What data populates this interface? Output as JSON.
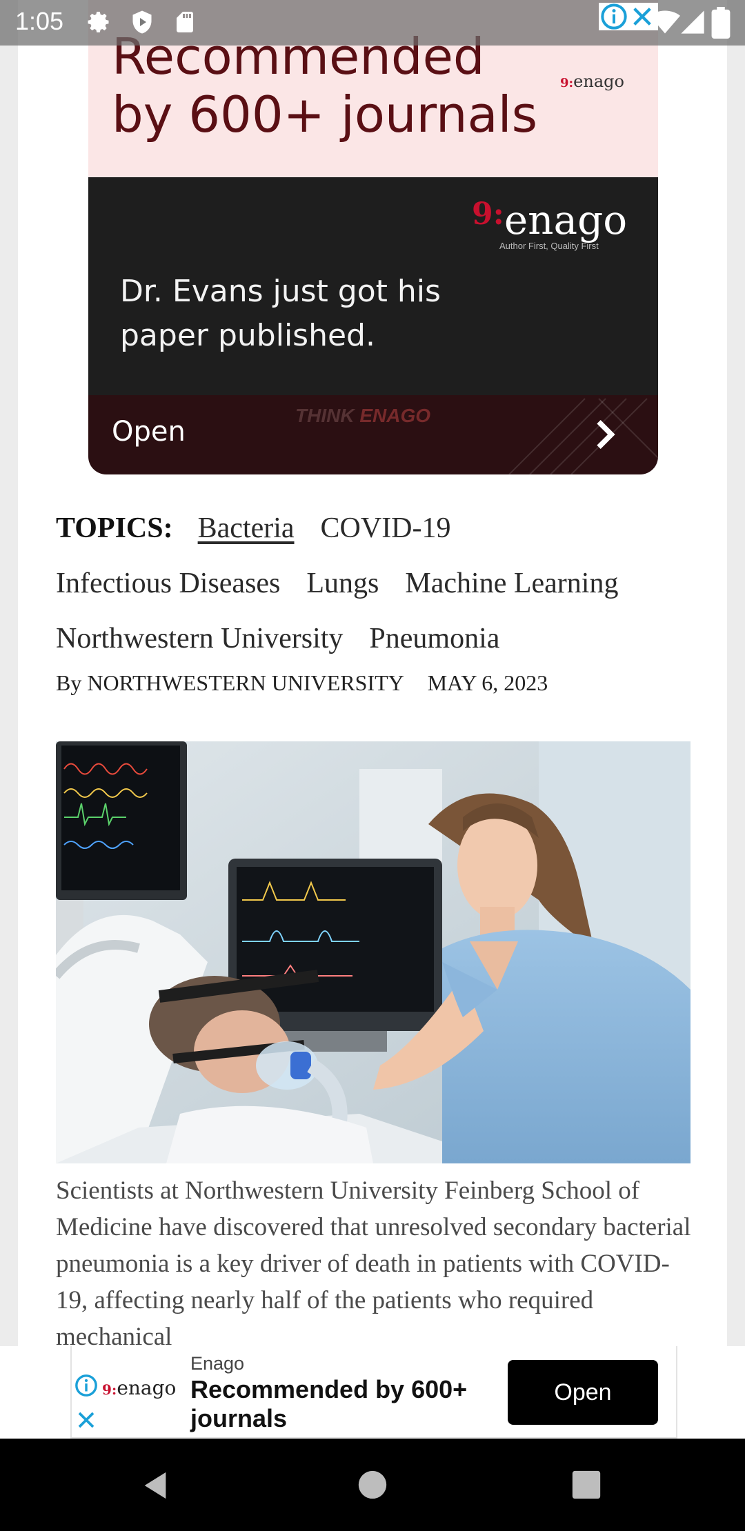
{
  "status_bar": {
    "time": "1:05",
    "icons": [
      "gear-icon",
      "shield-play-icon",
      "sd-card-icon",
      "wifi-icon",
      "signal-icon",
      "battery-icon"
    ]
  },
  "top_ad": {
    "headline": "Recommended by 600+ journals",
    "brand": "enago",
    "brand_tagline": "Author First, Quality First",
    "message": "Dr. Evans just got his paper published.",
    "cta_label": "Open",
    "watermark_think": "THINK",
    "watermark_brand": "ENAGO",
    "colors": {
      "pink": "#fbe6e6",
      "headline": "#5a0f14",
      "dark": "#1e1e1e",
      "cta_bg": "#2b0f12",
      "accent": "#c8102e"
    }
  },
  "topics": {
    "label": "TOPICS:",
    "tags": [
      "Bacteria",
      "COVID-19",
      "Infectious Diseases",
      "Lungs",
      "Machine Learning",
      "Northwestern University",
      "Pneumonia"
    ]
  },
  "byline": {
    "author": "By NORTHWESTERN UNIVERSITY",
    "date": "MAY 6, 2023"
  },
  "hero_image": {
    "subject": "nurse-with-ventilated-patient"
  },
  "caption": "Scientists at Northwestern University Feinberg School of Medicine have discovered that unresolved secondary bacterial pneumonia is a key driver of death in patients with COVID-19, affecting nearly half of the patients who required mechanical",
  "bottom_ad": {
    "advertiser": "Enago",
    "title": "Recommended by 600+ journals",
    "button": "Open",
    "brand": "enago"
  },
  "nav_bar": {
    "buttons": [
      "back-icon",
      "home-icon",
      "recents-icon"
    ]
  }
}
